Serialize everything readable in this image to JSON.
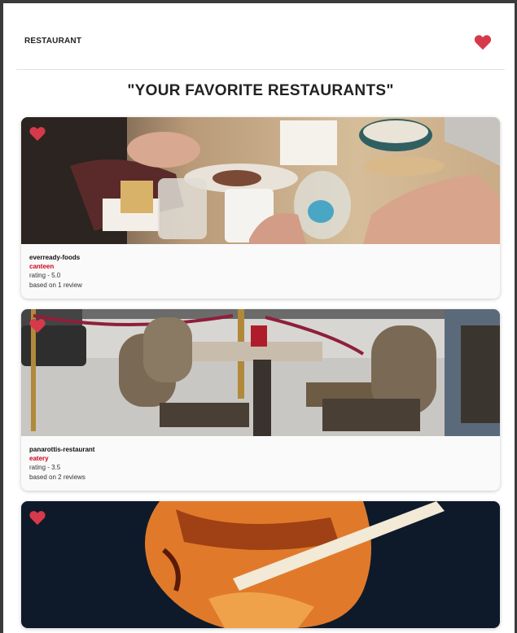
{
  "colors": {
    "accent": "#d63a4a",
    "type_label": "#d0021b"
  },
  "header": {
    "brand": "RESTAURANT",
    "favorites_icon": "heart-icon"
  },
  "page": {
    "title": "\"YOUR FAVORITE RESTAURANTS\""
  },
  "restaurants": [
    {
      "name": "everready-foods",
      "type": "canteen",
      "rating": "rating - 5.0",
      "reviews": "based on 1 review",
      "favorite_icon": "heart-icon"
    },
    {
      "name": "panarottis-restaurant",
      "type": "eatery",
      "rating": "rating - 3.5",
      "reviews": "based on 2 reviews",
      "favorite_icon": "heart-icon"
    },
    {
      "name": "",
      "type": "",
      "rating": "",
      "reviews": "",
      "favorite_icon": "heart-icon"
    }
  ]
}
